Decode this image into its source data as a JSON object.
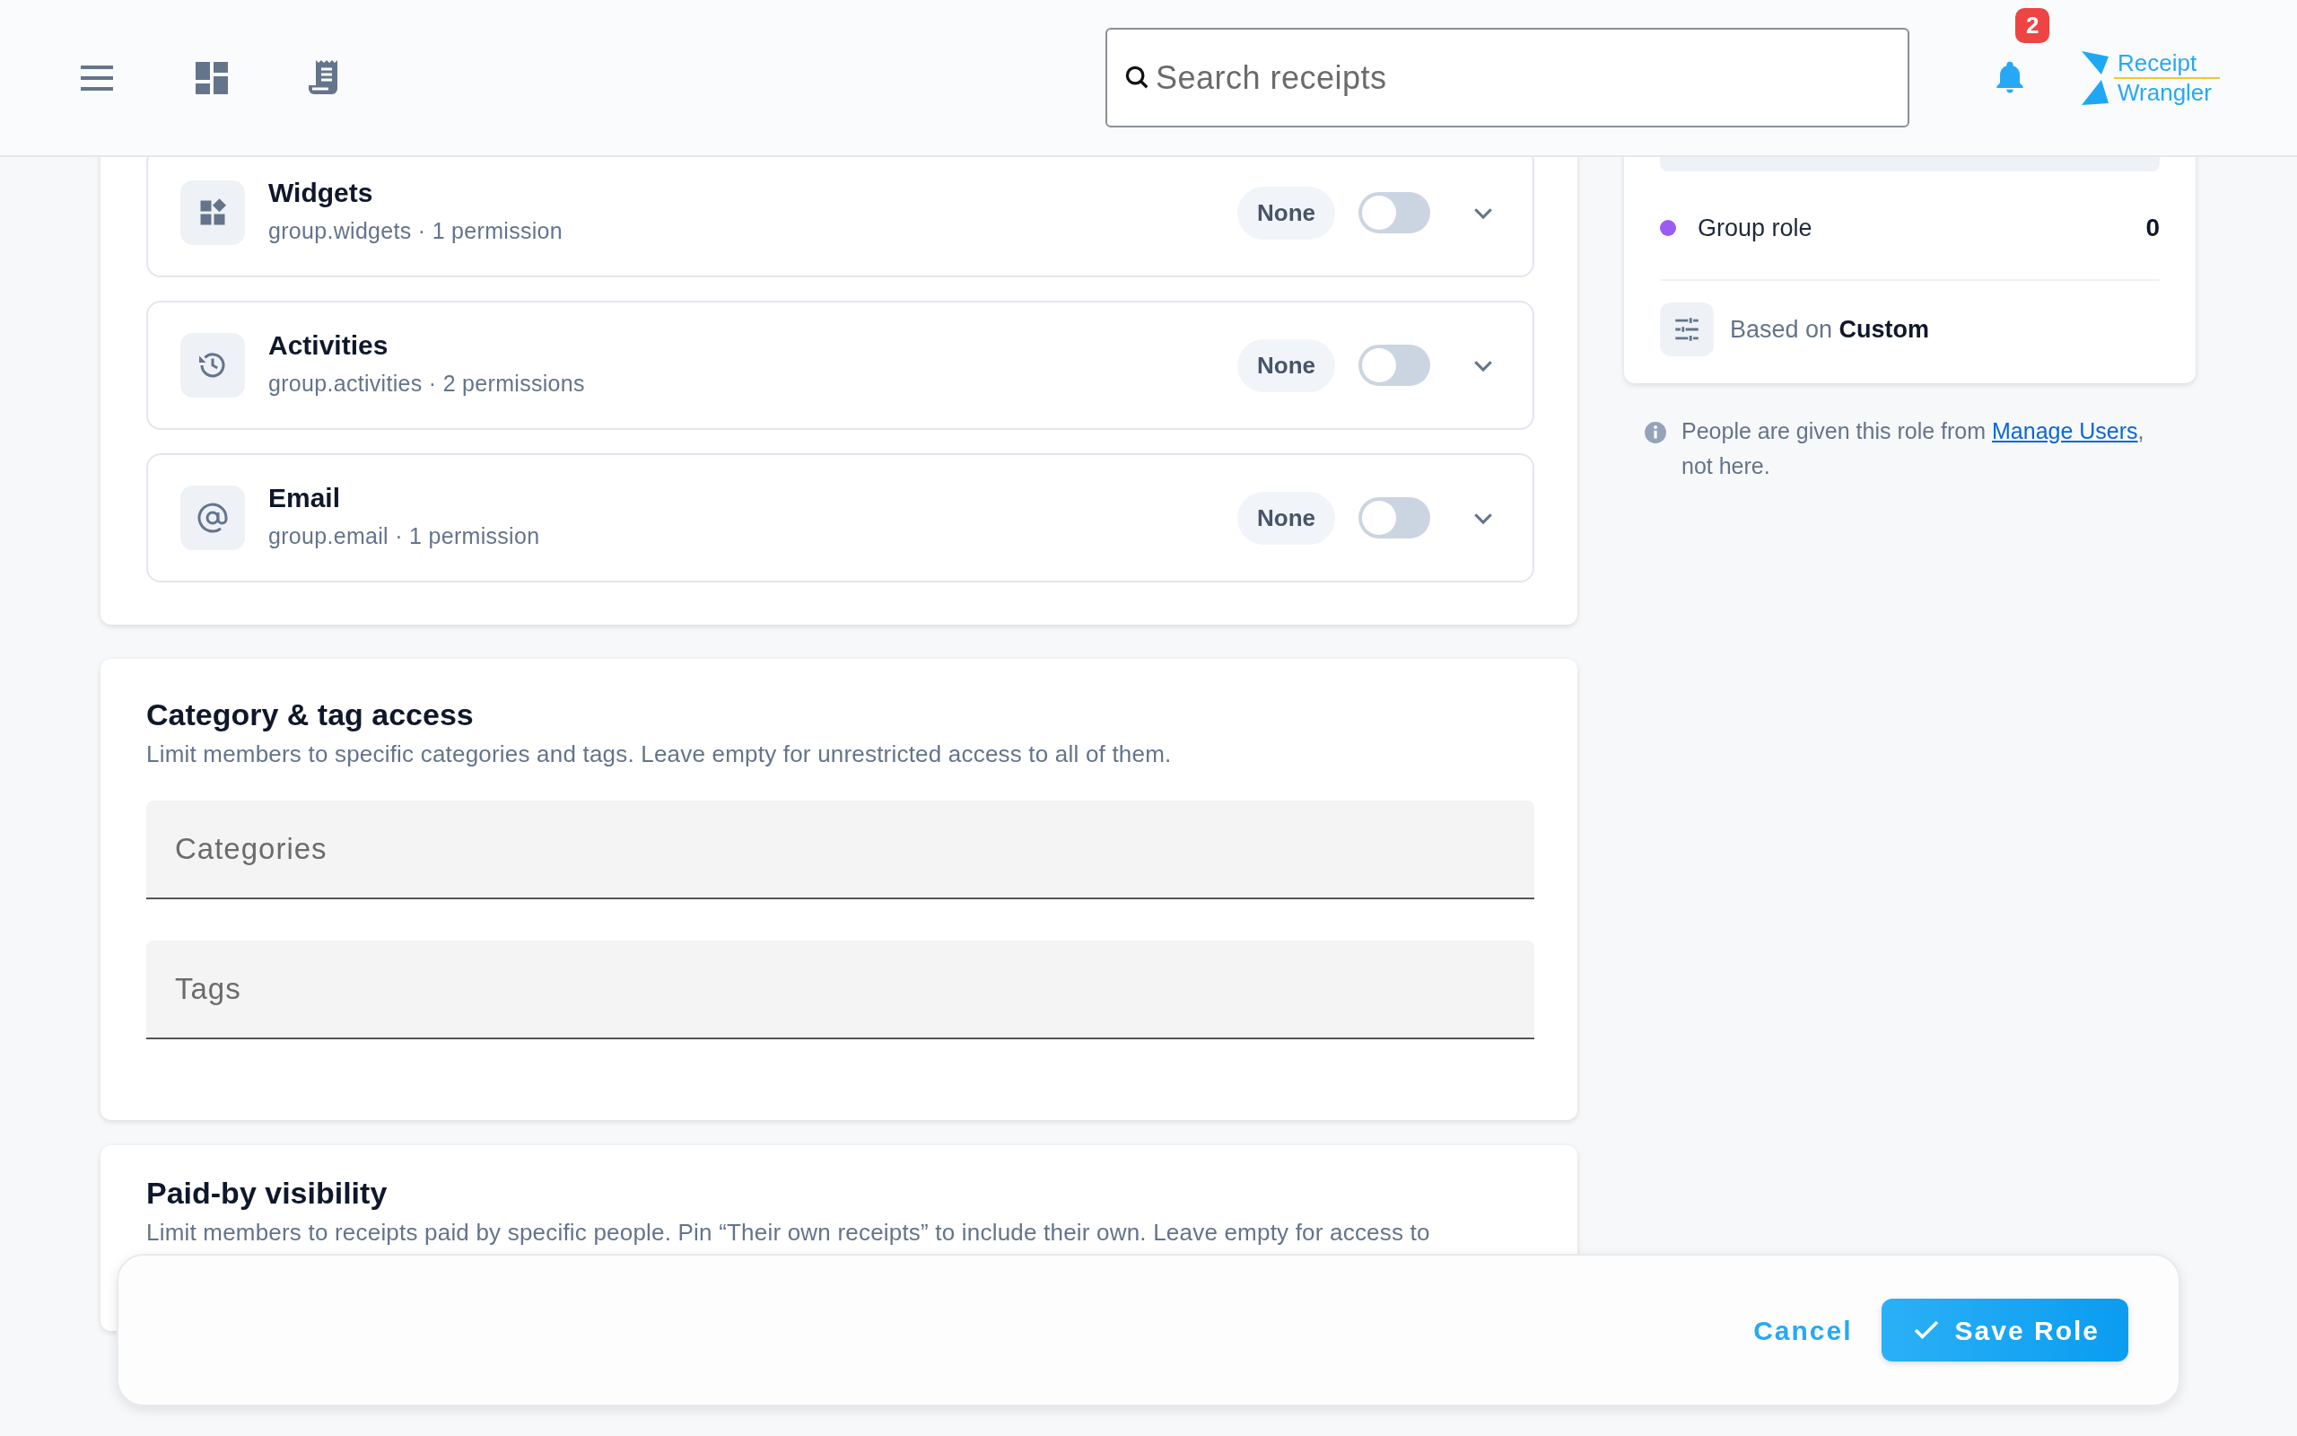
{
  "topbar": {
    "search": {
      "placeholder": "Search receipts"
    },
    "notifications": {
      "count": "2"
    },
    "logo": {
      "line_1": "Receipt",
      "line_2": "Wrangler"
    }
  },
  "permission_groups": [
    {
      "kind": "widgets",
      "title": "Widgets",
      "subtitle": "group.widgets · 1 permission",
      "access": "None",
      "on": false
    },
    {
      "kind": "activities",
      "title": "Activities",
      "subtitle": "group.activities · 2 permissions",
      "access": "None",
      "on": false
    },
    {
      "kind": "email",
      "title": "Email",
      "subtitle": "group.email · 1 permission",
      "access": "None",
      "on": false
    }
  ],
  "category_access": {
    "title": "Category & tag access",
    "description": "Limit members to specific categories and tags. Leave empty for unrestricted access to all of them.",
    "fields": [
      {
        "placeholder": "Categories"
      },
      {
        "placeholder": "Tags"
      }
    ]
  },
  "paid_by": {
    "title": "Paid-by visibility",
    "description": "Limit members to receipts paid by specific people. Pin “Their own receipts” to include their own. Leave empty for access to"
  },
  "summary": {
    "legend": [
      {
        "label": "Group role",
        "count": "0",
        "color": "#9b5cf6"
      }
    ],
    "based_on": "Based on **Custom**"
  },
  "note": {
    "before": "People are given this role from ",
    "link": "Manage Users",
    "after": ", not here."
  },
  "actions": [
    {
      "kind": "text",
      "label": "Cancel"
    },
    {
      "kind": "primary",
      "label": "Save Role"
    }
  ]
}
